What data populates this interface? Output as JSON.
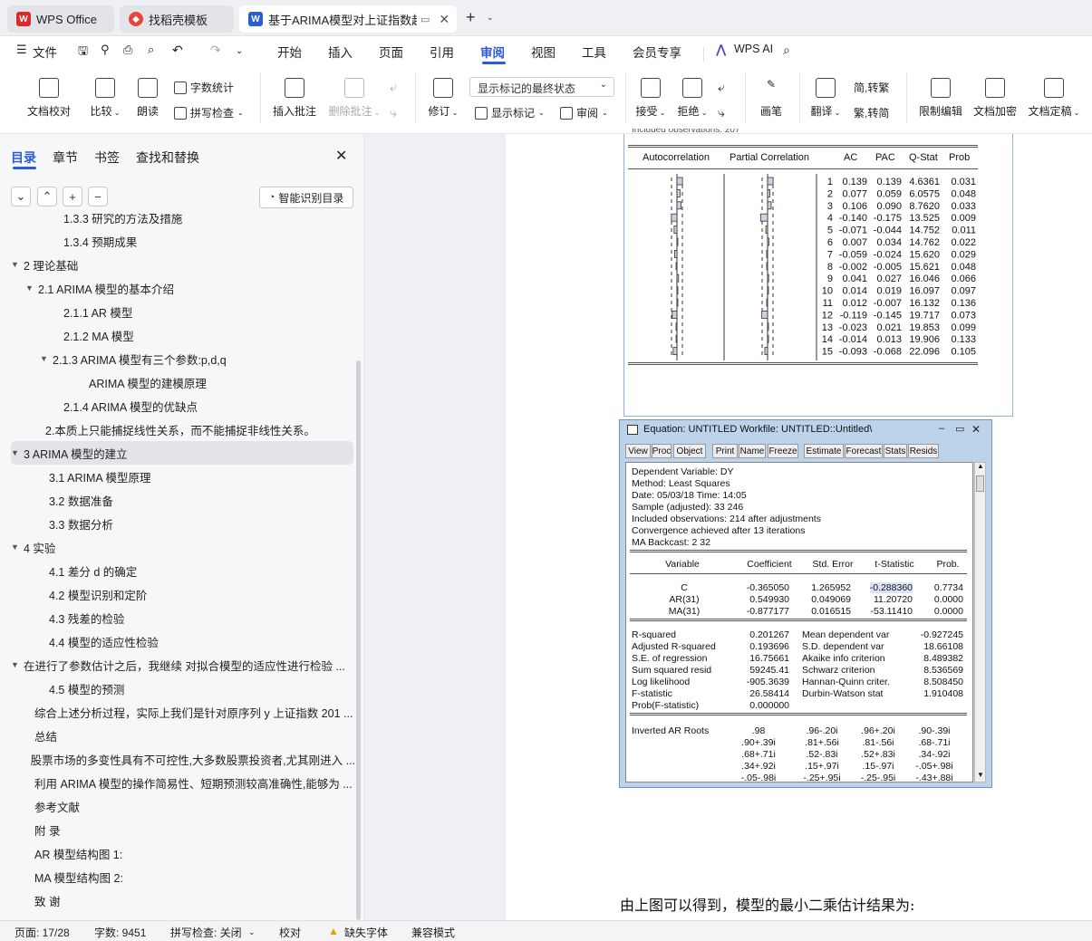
{
  "tabs": [
    {
      "label": "WPS Office",
      "icon": "wps-logo-icon"
    },
    {
      "label": "找稻壳模板",
      "icon": "docer-icon"
    },
    {
      "label": "基于ARIMA模型对上证指数趋",
      "icon": "word-doc-icon"
    }
  ],
  "menu": {
    "file": "文件",
    "items": [
      "开始",
      "插入",
      "页面",
      "引用",
      "审阅",
      "视图",
      "工具",
      "会员专享"
    ],
    "active": "审阅",
    "ai": "WPS AI"
  },
  "ribbon": {
    "doc_check": "文档校对",
    "compare": "比较",
    "read": "朗读",
    "word_count": "字数统计",
    "spell_check": "拼写检查",
    "insert_comment": "插入批注",
    "delete_comment": "删除批注",
    "revise": "修订",
    "display_select": "显示标记的最终状态",
    "show_marks": "显示标记",
    "review": "审阅",
    "accept": "接受",
    "reject": "拒绝",
    "pen": "画笔",
    "translate": "翻译",
    "to_trad": "简,转繁",
    "to_simp": "繁,转简",
    "restrict": "限制编辑",
    "encrypt": "文档加密",
    "finalize": "文档定稿"
  },
  "nav": {
    "tabs": [
      "目录",
      "章节",
      "书签",
      "查找和替换"
    ],
    "active": "目录",
    "smart": "智能识别目录",
    "items": [
      {
        "text": "1.3.3 研究的方法及措施",
        "level": 3,
        "arrow": ""
      },
      {
        "text": "1.3.4 预期成果",
        "level": 3,
        "arrow": ""
      },
      {
        "text": "2 理论基础",
        "level": 1,
        "arrow": "▼"
      },
      {
        "text": "2.1 ARIMA 模型的基本介绍",
        "level": 2,
        "arrow": "▼"
      },
      {
        "text": "2.1.1   AR 模型",
        "level": 3,
        "arrow": ""
      },
      {
        "text": "2.1.2   MA 模型",
        "level": 3,
        "arrow": ""
      },
      {
        "text": "2.1.3 ARIMA 模型有三个参数:p,d,q",
        "level": 3,
        "arrow": "▼"
      },
      {
        "text": "ARIMA 模型的建模原理",
        "level": 4,
        "arrow": ""
      },
      {
        "text": "2.1.4 ARIMA 模型的优缺点",
        "level": 3,
        "arrow": ""
      },
      {
        "text": "2.本质上只能捕捉线性关系，而不能捕捉非线性关系。",
        "level": 0,
        "arrow": ""
      },
      {
        "text": "3 ARIMA 模型的建立",
        "level": 1,
        "arrow": "▼",
        "selected": true
      },
      {
        "text": "3.1 ARIMA 模型原理",
        "level": 2,
        "arrow": ""
      },
      {
        "text": " 3.2  数据准备",
        "level": 2,
        "arrow": ""
      },
      {
        "text": "3.3  数据分析",
        "level": 2,
        "arrow": ""
      },
      {
        "text": "4  实验",
        "level": 1,
        "arrow": "▼"
      },
      {
        "text": "4.1  差分 d 的确定",
        "level": 2,
        "arrow": ""
      },
      {
        "text": "4.2 模型识别和定阶",
        "level": 2,
        "arrow": ""
      },
      {
        "text": "4.3  残差的检验",
        "level": 2,
        "arrow": ""
      },
      {
        "text": "4.4 模型的适应性检验",
        "level": 2,
        "arrow": ""
      },
      {
        "text": "在进行了参数估计之后，我继续 对拟合模型的适应性进行检验 ...",
        "level": 1,
        "arrow": "▼"
      },
      {
        "text": "4.5 模型的预测",
        "level": 2,
        "arrow": ""
      },
      {
        "text": "综合上述分析过程，实际上我们是针对原序列 y 上证指数 201 ...",
        "level": 1,
        "arrow": ""
      },
      {
        "text": "总结",
        "level": 1,
        "arrow": ""
      },
      {
        "text": "股票市场的多变性具有不可控性,大多数股票投资者,尤其刚进入 ...",
        "level": 1,
        "arrow": ""
      },
      {
        "text": "利用 ARIMA 模型的操作简易性、短期预测较高准确性,能够为 ...",
        "level": 1,
        "arrow": ""
      },
      {
        "text": "参考文献",
        "level": 1,
        "arrow": ""
      },
      {
        "text": "附  录",
        "level": 1,
        "arrow": ""
      },
      {
        "text": "AR 模型结构图 1:",
        "level": 1,
        "arrow": ""
      },
      {
        "text": "MA 模型结构图 2:",
        "level": 1,
        "arrow": ""
      },
      {
        "text": "致  谢",
        "level": 1,
        "arrow": ""
      }
    ]
  },
  "correlogram": {
    "cut_line": "Included observations: 207",
    "headers": [
      "Autocorrelation",
      "Partial Correlation",
      "AC",
      "PAC",
      "Q-Stat",
      "Prob"
    ],
    "rows": [
      [
        "1",
        "0.139",
        "0.139",
        "4.6361",
        "0.031"
      ],
      [
        "2",
        "0.077",
        "0.059",
        "6.0575",
        "0.048"
      ],
      [
        "3",
        "0.106",
        "0.090",
        "8.7620",
        "0.033"
      ],
      [
        "4",
        "-0.140",
        "-0.175",
        "13.525",
        "0.009"
      ],
      [
        "5",
        "-0.071",
        "-0.044",
        "14.752",
        "0.011"
      ],
      [
        "6",
        "0.007",
        "0.034",
        "14.762",
        "0.022"
      ],
      [
        "7",
        "-0.059",
        "-0.024",
        "15.620",
        "0.029"
      ],
      [
        "8",
        "-0.002",
        "-0.005",
        "15.621",
        "0.048"
      ],
      [
        "9",
        "0.041",
        "0.027",
        "16.046",
        "0.066"
      ],
      [
        "10",
        "0.014",
        "0.019",
        "16.097",
        "0.097"
      ],
      [
        "11",
        "0.012",
        "-0.007",
        "16.132",
        "0.136"
      ],
      [
        "12",
        "-0.119",
        "-0.145",
        "19.717",
        "0.073"
      ],
      [
        "13",
        "-0.023",
        "0.021",
        "19.853",
        "0.099"
      ],
      [
        "14",
        "-0.014",
        "0.013",
        "19.906",
        "0.133"
      ],
      [
        "15",
        "-0.093",
        "-0.068",
        "22.096",
        "0.105"
      ]
    ]
  },
  "equation": {
    "title": "Equation: UNTITLED   Workfile: UNTITLED::Untitled\\",
    "buttons": [
      "View",
      "Proc",
      "Object",
      "Print",
      "Name",
      "Freeze",
      "Estimate",
      "Forecast",
      "Stats",
      "Resids"
    ],
    "header_lines": [
      "Dependent Variable: DY",
      "Method: Least Squares",
      "Date: 05/03/18   Time: 14:05",
      "Sample (adjusted): 33 246",
      "Included observations: 214 after adjustments",
      "Convergence achieved after 13 iterations",
      "MA Backcast: 2 32"
    ],
    "col_headers": [
      "Variable",
      "Coefficient",
      "Std. Error",
      "t-Statistic",
      "Prob."
    ],
    "coef_rows": [
      [
        "C",
        "-0.365050",
        "1.265952",
        "-0.288360",
        "0.7734"
      ],
      [
        "AR(31)",
        "0.549930",
        "0.049069",
        "11.20720",
        "0.0000"
      ],
      [
        "MA(31)",
        "-0.877177",
        "0.016515",
        "-53.11410",
        "0.0000"
      ]
    ],
    "stats_rows": [
      [
        "R-squared",
        "0.201267",
        "Mean dependent var",
        "-0.927245"
      ],
      [
        "Adjusted R-squared",
        "0.193696",
        "S.D. dependent var",
        "18.66108"
      ],
      [
        "S.E. of regression",
        "16.75661",
        "Akaike info criterion",
        "8.489382"
      ],
      [
        "Sum squared resid",
        "59245.41",
        "Schwarz criterion",
        "8.536569"
      ],
      [
        "Log likelihood",
        "-905.3639",
        "Hannan-Quinn criter.",
        "8.508450"
      ],
      [
        "F-statistic",
        "26.58414",
        "Durbin-Watson stat",
        "1.910408"
      ],
      [
        "Prob(F-statistic)",
        "0.000000",
        "",
        ""
      ]
    ],
    "roots_label": "Inverted AR Roots",
    "roots_rows": [
      [
        ".98",
        ".96-.20i",
        ".96+.20i",
        ".90-.39i"
      ],
      [
        ".90+.39i",
        ".81+.56i",
        ".81-.56i",
        ".68-.71i"
      ],
      [
        ".68+.71i",
        ".52-.83i",
        ".52+.83i",
        ".34-.92i"
      ],
      [
        ".34+.92i",
        ".15+.97i",
        ".15-.97i",
        "-.05+.98i"
      ],
      [
        "-.05-.98i",
        "-.25+.95i",
        "-.25-.95i",
        "-.43+.88i"
      ]
    ]
  },
  "doc_text": "由上图可以得到，模型的最小二乘估计结果为:",
  "status": {
    "page": "页面: 17/28",
    "words": "字数: 9451",
    "spell": "拼写检查: 关闭",
    "proof": "校对",
    "missing_font": "缺失字体",
    "compat": "兼容模式"
  },
  "colors": {
    "accent": "#2b5cd8",
    "wps_red": "#e0282b",
    "selected_row": "#e3e4e8"
  }
}
